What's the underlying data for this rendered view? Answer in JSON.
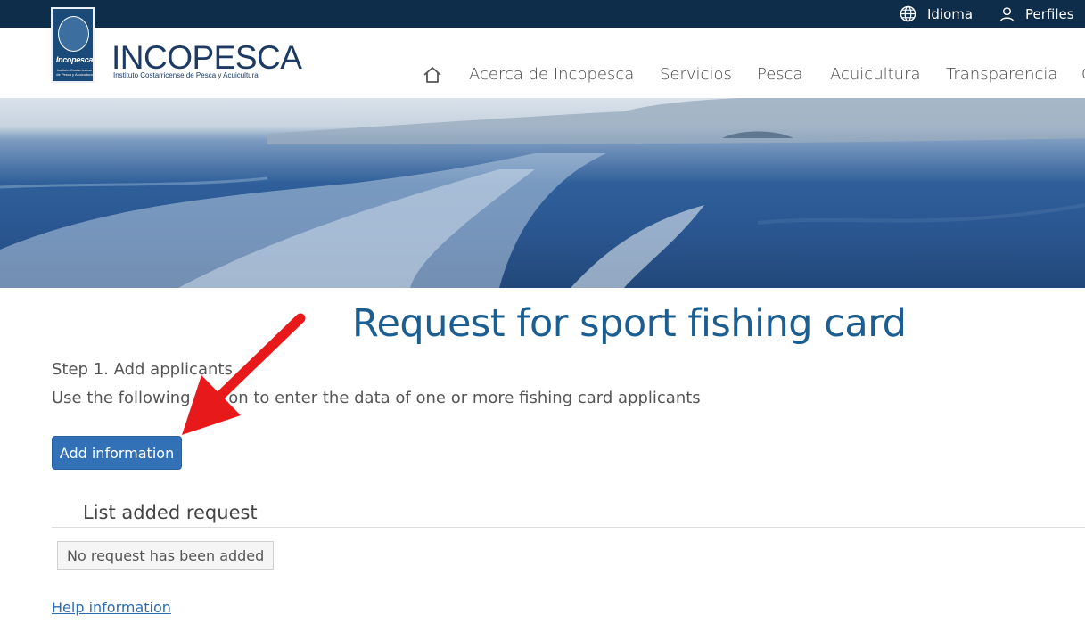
{
  "topbar": {
    "language_label": "Idioma",
    "profiles_label": "Perfiles"
  },
  "logo": {
    "brand": "Incopesca",
    "subtext": "Instituto Costarricense de Pesca y Acuicultura"
  },
  "wordmark": {
    "name": "INCOPESCA",
    "tagline": "Instituto Costarricense de Pesca y Acuicultura"
  },
  "nav": {
    "items": [
      {
        "label": "Acerca de Incopesca"
      },
      {
        "label": "Servicios"
      },
      {
        "label": "Pesca"
      },
      {
        "label": "Acuicultura"
      },
      {
        "label": "Transparencia"
      },
      {
        "label": "C"
      }
    ]
  },
  "page": {
    "title": "Request for sport fishing card",
    "step": "Step 1. Add applicants",
    "instructions": "Use the following button to enter the data of one or more fishing card applicants",
    "add_button": "Add information",
    "list_title": "List added request",
    "empty_message": "No request has been added",
    "help_link": "Help information"
  },
  "colors": {
    "topbar": "#0d2d4a",
    "title": "#1b5e92",
    "button": "#3271b5",
    "arrow": "#e8191b"
  }
}
